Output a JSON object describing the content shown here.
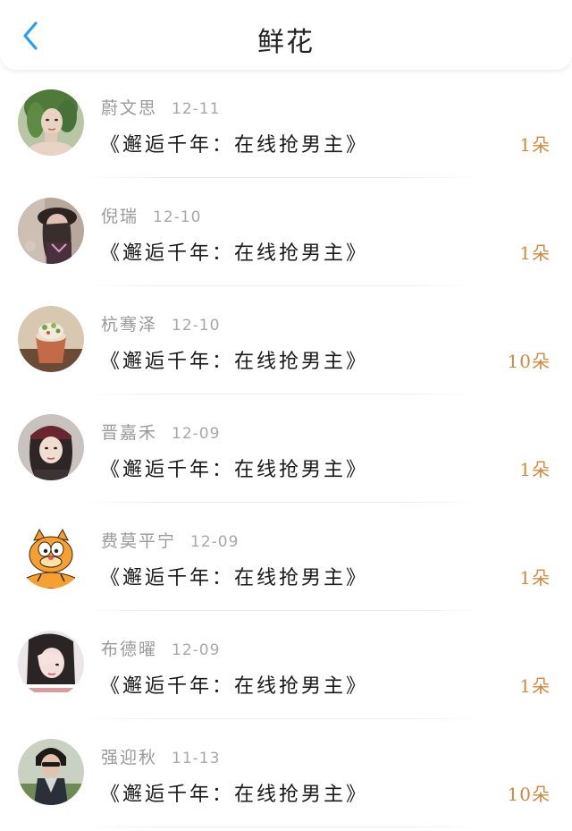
{
  "header": {
    "title": "鲜花",
    "back_icon": "chevron-left-icon",
    "accent_color": "#2a9df4"
  },
  "items": [
    {
      "name": "蔚文思",
      "date": "12-11",
      "book": "《邂逅千年：在线抢男主》",
      "count": "1朵",
      "avatar": "woman-green-hair-photo"
    },
    {
      "name": "倪瑞",
      "date": "12-10",
      "book": "《邂逅千年：在线抢男主》",
      "count": "1朵",
      "avatar": "girl-with-hat-photo"
    },
    {
      "name": "杭骞泽",
      "date": "12-10",
      "book": "《邂逅千年：在线抢男主》",
      "count": "10朵",
      "avatar": "dessert-cup-photo"
    },
    {
      "name": "晋嘉禾",
      "date": "12-09",
      "book": "《邂逅千年：在线抢男主》",
      "count": "1朵",
      "avatar": "girl-red-cap-photo"
    },
    {
      "name": "费莫平宁",
      "date": "12-09",
      "book": "《邂逅千年：在线抢男主》",
      "count": "1朵",
      "avatar": "garfield-cat-cartoon"
    },
    {
      "name": "布德曜",
      "date": "12-09",
      "book": "《邂逅千年：在线抢男主》",
      "count": "1朵",
      "avatar": "girl-covering-eye-photo"
    },
    {
      "name": "强迎秋",
      "date": "11-13",
      "book": "《邂逅千年：在线抢男主》",
      "count": "10朵",
      "avatar": "boy-sunglasses-photo"
    }
  ],
  "colors": {
    "count": "#d08840",
    "meta": "#9a9a9a",
    "book": "#1a1a1a"
  }
}
